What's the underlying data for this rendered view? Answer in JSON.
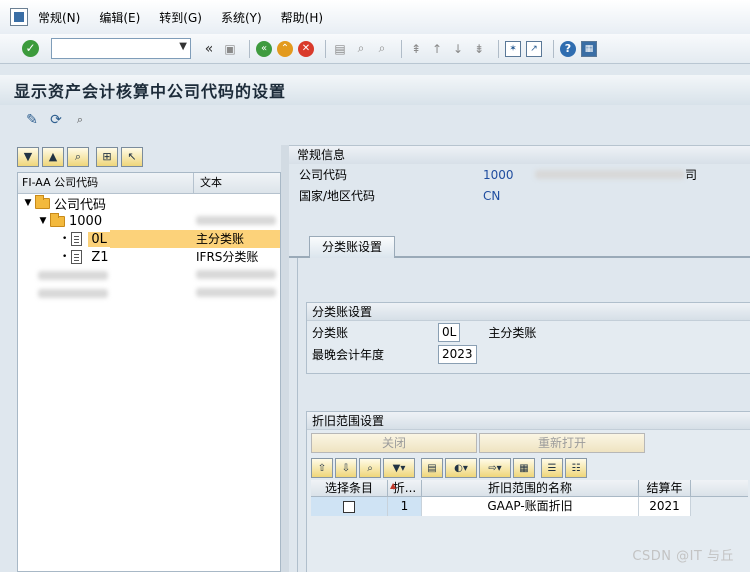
{
  "menu": {
    "items": [
      "常规(N)",
      "编辑(E)",
      "转到(G)",
      "系统(Y)",
      "帮助(H)"
    ]
  },
  "toolbar": {
    "command_value": "",
    "back_symbol": "«"
  },
  "page": {
    "title": "显示资产会计核算中公司代码的设置"
  },
  "tree": {
    "col1_header": "FI-AA 公司代码",
    "col2_header": "文本",
    "root_label": "公司代码",
    "company_code": "1000",
    "ledgers": [
      {
        "code": "0L",
        "text": "主分类账"
      },
      {
        "code": "Z1",
        "text": "IFRS分类账"
      }
    ]
  },
  "general_info": {
    "group_title": "常规信息",
    "company_code_label": "公司代码",
    "company_code_value": "1000",
    "company_name_suffix": "司",
    "country_label": "国家/地区代码",
    "country_value": "CN"
  },
  "tab": {
    "label": "分类账设置"
  },
  "ledger_settings": {
    "group_title": "分类账设置",
    "ledger_label": "分类账",
    "ledger_value": "0L",
    "ledger_text": "主分类账",
    "fiscal_year_label": "最晚会计年度",
    "fiscal_year_value": "2023"
  },
  "depreciation": {
    "group_title": "折旧范围设置",
    "close_button": "关闭",
    "reopen_button": "重新打开",
    "columns": [
      "选择条目",
      "折...",
      "折旧范围的名称",
      "结算年"
    ],
    "rows": [
      {
        "area": "1",
        "name": "GAAP-账面折旧",
        "year": "2021"
      }
    ]
  },
  "watermark": "CSDN @IT 与丘"
}
